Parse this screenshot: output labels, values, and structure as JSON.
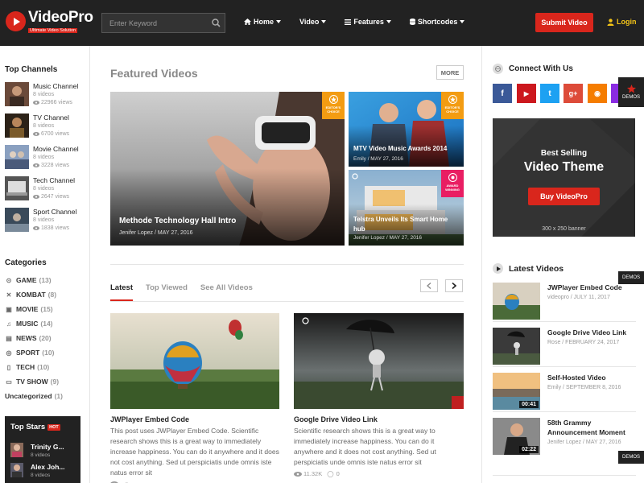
{
  "brand": {
    "name": "VideoPro",
    "tagline": "Ultimate Video Solution"
  },
  "search": {
    "placeholder": "Enter Keyword"
  },
  "nav": [
    {
      "label": "Home",
      "icon": "home-icon"
    },
    {
      "label": "Video",
      "icon": ""
    },
    {
      "label": "Features",
      "icon": "menu-icon"
    },
    {
      "label": "Shortcodes",
      "icon": "database-icon"
    }
  ],
  "header": {
    "submit_label": "Submit Video",
    "login_label": "Login"
  },
  "left": {
    "channels_title": "Top Channels",
    "channels": [
      {
        "name": "Music Channel",
        "videos": "8 videos",
        "views": "22966 views"
      },
      {
        "name": "TV Channel",
        "videos": "8 videos",
        "views": "6700 views"
      },
      {
        "name": "Movie Channel",
        "videos": "8 videos",
        "views": "3228 views"
      },
      {
        "name": "Tech Channel",
        "videos": "8 videos",
        "views": "2647 views"
      },
      {
        "name": "Sport Channel",
        "videos": "8 videos",
        "views": "1838 views"
      }
    ],
    "categories_title": "Categories",
    "categories": [
      {
        "name": "GAME",
        "count": "(13)"
      },
      {
        "name": "KOMBAT",
        "count": "(8)"
      },
      {
        "name": "MOVIE",
        "count": "(15)"
      },
      {
        "name": "MUSIC",
        "count": "(14)"
      },
      {
        "name": "NEWS",
        "count": "(20)"
      },
      {
        "name": "SPORT",
        "count": "(10)"
      },
      {
        "name": "TECH",
        "count": "(10)"
      },
      {
        "name": "TV SHOW",
        "count": "(9)"
      },
      {
        "name": "Uncategorized",
        "count": "(1)"
      }
    ],
    "stars_title": "Top Stars",
    "stars_badge": "HOT",
    "stars": [
      {
        "name": "Trinity G...",
        "meta": "8 videos"
      },
      {
        "name": "Alex Joh...",
        "meta": "8 videos"
      }
    ]
  },
  "featured": {
    "title": "Featured Videos",
    "more_label": "MORE",
    "cards": [
      {
        "title": "Methode Technology Hall Intro",
        "meta": "Jenifer Lopez  /  MAY 27, 2016",
        "badge": "EDITOR'S CHOICE"
      },
      {
        "title": "MTV Video Music Awards 2014",
        "meta": "Emily  /  MAY 27, 2016",
        "badge": "EDITOR'S CHOICE"
      },
      {
        "title": "Telstra Unveils Its Smart Home hub",
        "meta": "Jenifer Lopez  /  MAY 27, 2016",
        "badge": "AWARD WINNING"
      }
    ]
  },
  "tabs": [
    "Latest",
    "Top Viewed",
    "See All Videos"
  ],
  "videos": [
    {
      "title": "JWPlayer Embed Code",
      "desc": "This post uses JWPlayer Embed Code. Scientific research shows this is a great way to immediately increase happiness. You can do it anywhere and it does not cost anything. Sed ut perspiciatis unde omnis iste natus error sit",
      "views": "",
      "comments": ""
    },
    {
      "title": "Google Drive Video Link",
      "desc": "Scientific research shows this is a great way to immediately increase happiness. You can do it anywhere and it does not cost anything. Sed ut perspiciatis unde omnis iste natus error sit",
      "views": "11.32K",
      "comments": "0"
    }
  ],
  "right": {
    "connect_title": "Connect With Us",
    "social": [
      {
        "icon": "facebook-icon",
        "glyph": "f",
        "color": "#3b5998"
      },
      {
        "icon": "youtube-icon",
        "glyph": "▶",
        "color": "#cc181e"
      },
      {
        "icon": "twitter-icon",
        "glyph": "t",
        "color": "#1da1f2"
      },
      {
        "icon": "google-plus-icon",
        "glyph": "g+",
        "color": "#dd4b39"
      },
      {
        "icon": "rss-icon",
        "glyph": "◉",
        "color": "#f57d00"
      },
      {
        "icon": "extra-social-icon",
        "glyph": "",
        "color": "#8a2be2"
      }
    ],
    "demos_label": "DEMOS",
    "banner": {
      "line1": "Best Selling",
      "line2": "Video Theme",
      "button": "Buy VideoPro",
      "size": "300 x 250 banner"
    },
    "latest_title": "Latest Videos",
    "latest": [
      {
        "title": "JWPlayer Embed Code",
        "meta": "videopro  /  JULY 11, 2017",
        "duration": ""
      },
      {
        "title": "Google Drive Video Link",
        "meta": "Rose  /  FEBRUARY 24, 2017",
        "duration": ""
      },
      {
        "title": "Self-Hosted Video",
        "meta": "Emily  /  SEPTEMBER 8, 2016",
        "duration": "00:41"
      },
      {
        "title": "58th Grammy Announcement Moment",
        "meta": "Jenifer Lopez  /  MAY 27, 2016",
        "duration": "02:22"
      }
    ]
  },
  "colors": {
    "accent": "#d9261c",
    "header_bg": "#222222",
    "badge_orange": "#f39c12",
    "badge_pink": "#e91e63"
  }
}
